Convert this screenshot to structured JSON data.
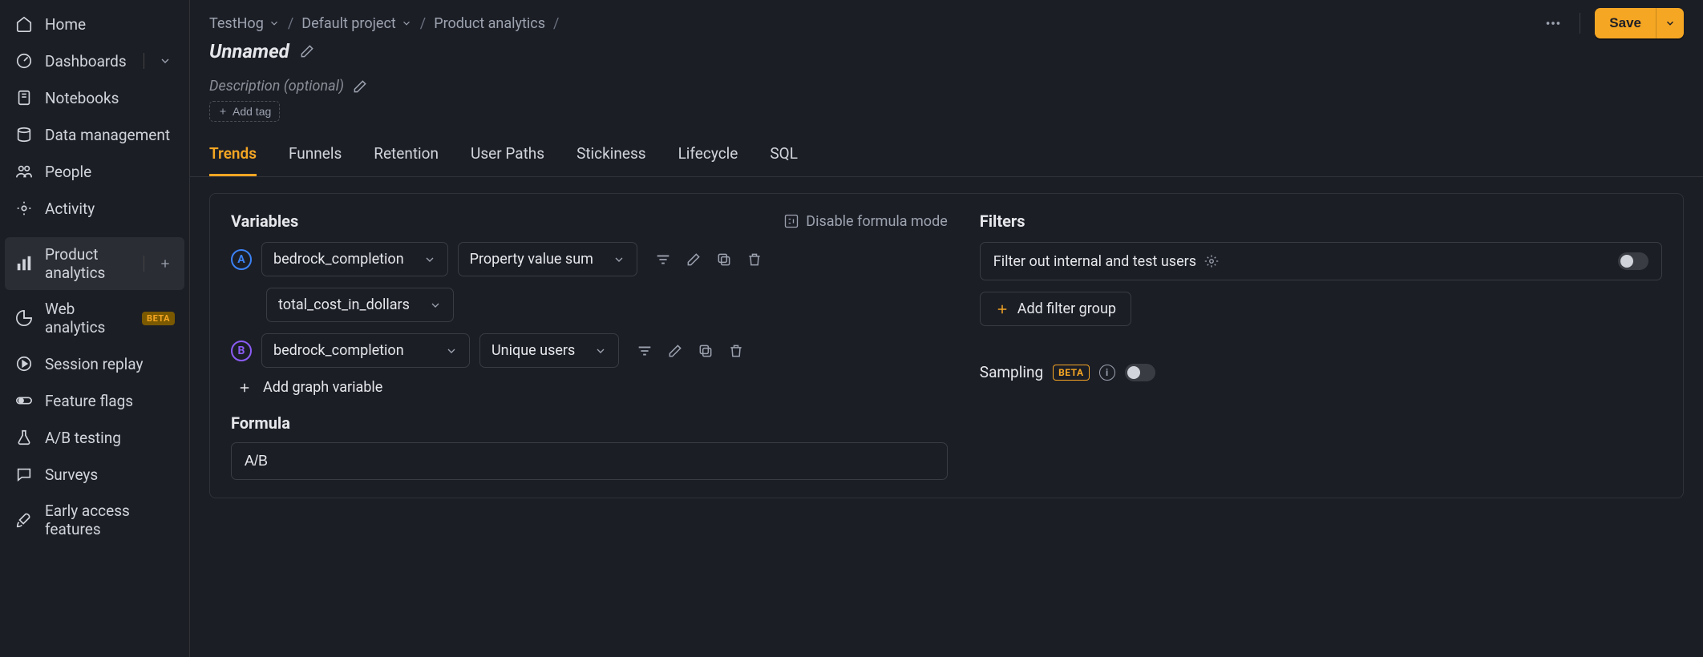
{
  "sidebar": {
    "items": [
      {
        "label": "Home",
        "icon": "home-icon"
      },
      {
        "label": "Dashboards",
        "icon": "gauge-icon"
      },
      {
        "label": "Notebooks",
        "icon": "notebook-icon"
      },
      {
        "label": "Data management",
        "icon": "database-icon"
      },
      {
        "label": "People",
        "icon": "people-icon"
      },
      {
        "label": "Activity",
        "icon": "activity-icon"
      },
      {
        "label": "Product analytics",
        "icon": "bar-chart-icon",
        "active": true
      },
      {
        "label": "Web analytics",
        "icon": "pie-chart-icon",
        "badge": "BETA"
      },
      {
        "label": "Session replay",
        "icon": "play-icon"
      },
      {
        "label": "Feature flags",
        "icon": "toggle-icon"
      },
      {
        "label": "A/B testing",
        "icon": "flask-icon"
      },
      {
        "label": "Surveys",
        "icon": "chat-icon"
      },
      {
        "label": "Early access features",
        "icon": "rocket-icon"
      }
    ]
  },
  "breadcrumb": {
    "crumbs": [
      "TestHog",
      "Default project",
      "Product analytics"
    ],
    "sep": "/"
  },
  "header": {
    "save_label": "Save",
    "insight_title": "Unnamed",
    "description_label": "Description",
    "description_optional": "(optional)",
    "add_tag_label": "Add tag"
  },
  "tabs": [
    "Trends",
    "Funnels",
    "Retention",
    "User Paths",
    "Stickiness",
    "Lifecycle",
    "SQL"
  ],
  "active_tab": "Trends",
  "variables": {
    "section_title": "Variables",
    "disable_formula_label": "Disable formula mode",
    "rows": [
      {
        "letter": "A",
        "event": "bedrock_completion",
        "agg": "Property value sum",
        "prop": "total_cost_in_dollars"
      },
      {
        "letter": "B",
        "event": "bedrock_completion",
        "agg": "Unique users"
      }
    ],
    "add_variable_label": "Add graph variable",
    "formula_title": "Formula",
    "formula_value": "A/B"
  },
  "filters": {
    "section_title": "Filters",
    "internal_label": "Filter out internal and test users",
    "add_group_label": "Add filter group"
  },
  "sampling": {
    "label": "Sampling",
    "badge": "BETA"
  }
}
